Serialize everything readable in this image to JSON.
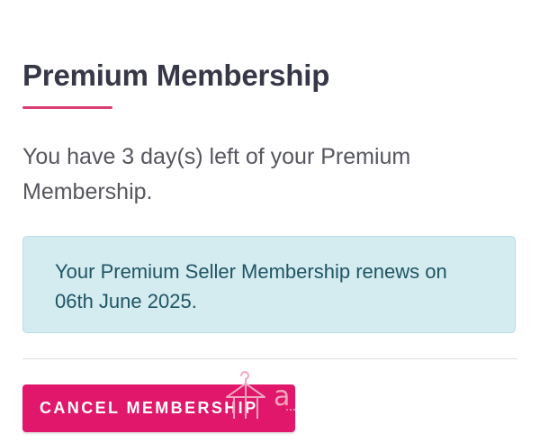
{
  "membership": {
    "title": "Premium Membership",
    "description": "You have 3 day(s) left of your Premium Membership.",
    "renewal_notice": "Your Premium Seller Membership renews on 06th June 2025.",
    "cancel_label": "CANCEL MEMBERSHIP"
  },
  "overlay": {
    "icon": "accessibility-hanger-icon"
  },
  "colors": {
    "accent": "#e0176a",
    "underline": "#d83f74",
    "info_bg": "#d4ebf0",
    "info_text": "#1f5563",
    "title_text": "#363847"
  }
}
